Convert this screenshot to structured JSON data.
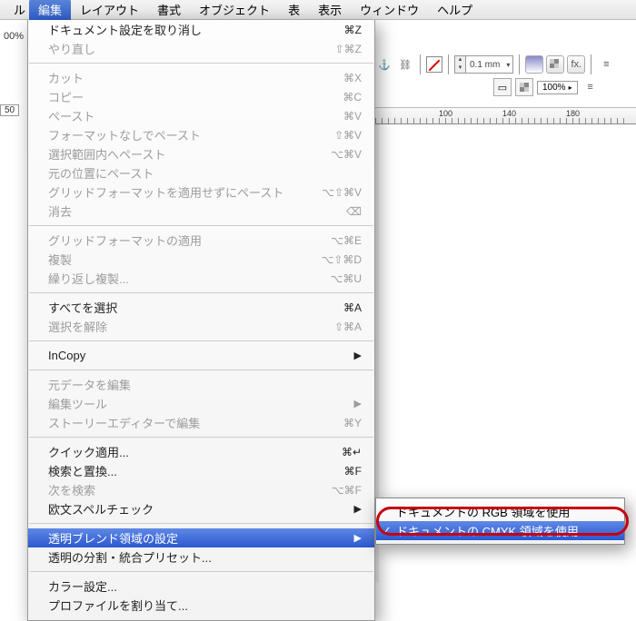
{
  "menubar": {
    "partial": "ル",
    "items": [
      "編集",
      "レイアウト",
      "書式",
      "オブジェクト",
      "表",
      "表示",
      "ウィンドウ",
      "ヘルプ"
    ],
    "active_index": 0
  },
  "left": {
    "pct": "00%",
    "num": "50"
  },
  "toolbar": {
    "stroke_value": "0.1 mm",
    "zoom_value": "100%"
  },
  "ruler": {
    "marks": [
      "",
      "100",
      "",
      "140",
      "",
      "180"
    ]
  },
  "menu": {
    "groups": [
      [
        {
          "label": "ドキュメント設定を取り消し",
          "shortcut": "⌘Z",
          "enabled": true
        },
        {
          "label": "やり直し",
          "shortcut": "⇧⌘Z",
          "enabled": false
        }
      ],
      [
        {
          "label": "カット",
          "shortcut": "⌘X",
          "enabled": false
        },
        {
          "label": "コピー",
          "shortcut": "⌘C",
          "enabled": false
        },
        {
          "label": "ペースト",
          "shortcut": "⌘V",
          "enabled": false
        },
        {
          "label": "フォーマットなしでペースト",
          "shortcut": "⇧⌘V",
          "enabled": false
        },
        {
          "label": "選択範囲内へペースト",
          "shortcut": "⌥⌘V",
          "enabled": false
        },
        {
          "label": "元の位置にペースト",
          "shortcut": "",
          "enabled": false
        },
        {
          "label": "グリッドフォーマットを適用せずにペースト",
          "shortcut": "⌥⇧⌘V",
          "enabled": false
        },
        {
          "label": "消去",
          "shortcut": "⌫",
          "enabled": false
        }
      ],
      [
        {
          "label": "グリッドフォーマットの適用",
          "shortcut": "⌥⌘E",
          "enabled": false
        },
        {
          "label": "複製",
          "shortcut": "⌥⇧⌘D",
          "enabled": false
        },
        {
          "label": "繰り返し複製...",
          "shortcut": "⌥⌘U",
          "enabled": false
        }
      ],
      [
        {
          "label": "すべてを選択",
          "shortcut": "⌘A",
          "enabled": true
        },
        {
          "label": "選択を解除",
          "shortcut": "⇧⌘A",
          "enabled": false
        }
      ],
      [
        {
          "label": "InCopy",
          "shortcut": "",
          "enabled": true,
          "submenu": true
        }
      ],
      [
        {
          "label": "元データを編集",
          "shortcut": "",
          "enabled": false
        },
        {
          "label": "編集ツール",
          "shortcut": "",
          "enabled": false,
          "submenu": true
        },
        {
          "label": "ストーリーエディターで編集",
          "shortcut": "⌘Y",
          "enabled": false
        }
      ],
      [
        {
          "label": "クイック適用...",
          "shortcut": "⌘↵",
          "enabled": true
        },
        {
          "label": "検索と置換...",
          "shortcut": "⌘F",
          "enabled": true
        },
        {
          "label": "次を検索",
          "shortcut": "⌥⌘F",
          "enabled": false
        },
        {
          "label": "欧文スペルチェック",
          "shortcut": "",
          "enabled": true,
          "submenu": true
        }
      ],
      [
        {
          "label": "透明ブレンド領域の設定",
          "shortcut": "",
          "enabled": true,
          "submenu": true,
          "highlight": true
        },
        {
          "label": "透明の分割・統合プリセット...",
          "shortcut": "",
          "enabled": true
        }
      ],
      [
        {
          "label": "カラー設定...",
          "shortcut": "",
          "enabled": true
        },
        {
          "label": "プロファイルを割り当て...",
          "shortcut": "",
          "enabled": true
        }
      ]
    ]
  },
  "submenu": {
    "items": [
      {
        "label": "ドキュメントの RGB 領域を使用",
        "checked": false,
        "highlight": false
      },
      {
        "label": "ドキュメントの CMYK 領域を使用",
        "checked": true,
        "highlight": true
      }
    ]
  }
}
